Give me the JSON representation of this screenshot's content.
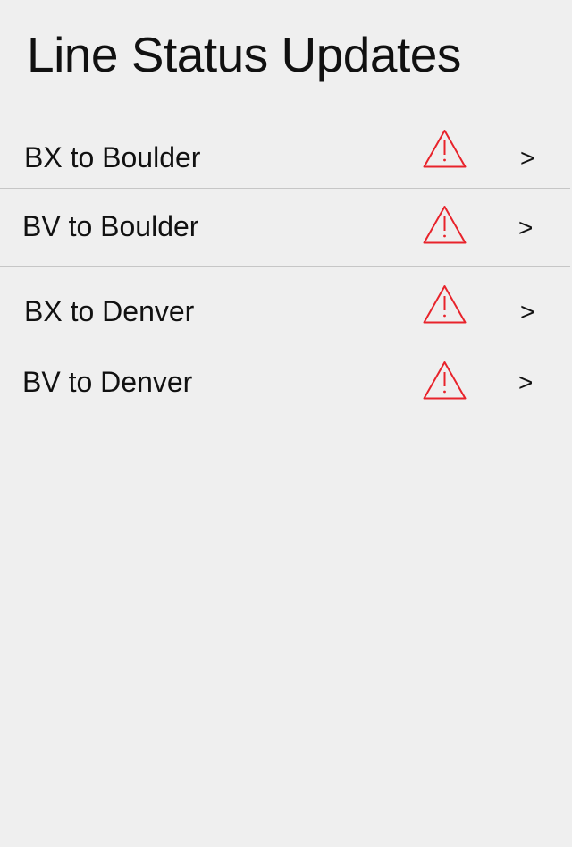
{
  "header": {
    "title": "Line Status Updates"
  },
  "colors": {
    "background": "#efefef",
    "text": "#111111",
    "alert": "#e8232b",
    "divider": "#c6c6c6"
  },
  "lines": [
    {
      "label": "BX to Boulder",
      "status_icon": "warning-icon",
      "chevron": ">"
    },
    {
      "label": "BV to Boulder",
      "status_icon": "warning-icon",
      "chevron": ">"
    },
    {
      "label": "BX to Denver",
      "status_icon": "warning-icon",
      "chevron": ">"
    },
    {
      "label": "BV to Denver",
      "status_icon": "warning-icon",
      "chevron": ">"
    }
  ]
}
